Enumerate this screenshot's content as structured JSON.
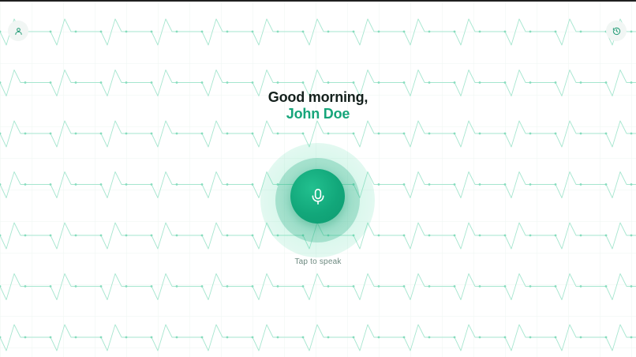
{
  "greeting": {
    "line1": "Good morning,",
    "name": "John Doe"
  },
  "mic": {
    "hint": "Tap to speak",
    "icon": "microphone-icon"
  },
  "header": {
    "left_icon": "user-icon",
    "right_icon": "history-icon"
  },
  "colors": {
    "accent": "#16a57a",
    "accent_light": "#34d399",
    "text_dark": "#14201c",
    "hint_text": "#6d8a80",
    "pattern_line": "#9fe3c9"
  }
}
